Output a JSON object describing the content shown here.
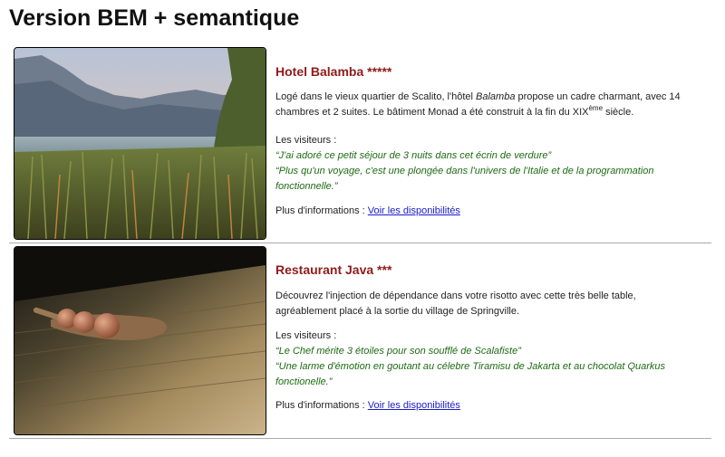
{
  "page": {
    "title": "Version BEM + semantique"
  },
  "cards": [
    {
      "title": "Hotel Balamba *****",
      "image": {
        "alt": "lake-landscape-image"
      },
      "description": {
        "before_em": "Logé dans le vieux quartier de Scalito, l'hôtel ",
        "em": "Balamba",
        "middle": " propose un cadre charmant, avec 14 chambres et 2 suites. Le bâtiment Monad a été construit à la fin du XIX",
        "sup": "ème",
        "after": " siècle."
      },
      "visitors_label": "Les visiteurs :",
      "quotes": [
        "“J'ai adoré ce petit séjour de 3 nuits dans cet écrin de verdure”",
        "“Plus qu'un voyage, c'est une plongée dans l'univers de l'Italie et de la programmation fonctionnelle.”"
      ],
      "more_label": "Plus d'informations : ",
      "link_label": "Voir les disponibilités"
    },
    {
      "title": "Restaurant Java ***",
      "image": {
        "alt": "wooden-spoon-image"
      },
      "description": {
        "text": "Découvrez l'injection de dépendance dans votre risotto avec cette très belle table, agréablement placé à la sortie du village de Springville."
      },
      "visitors_label": "Les visiteurs :",
      "quotes": [
        "“Le Chef mérite 3 étoiles pour son soufflé de Scalafiste”",
        "“Une larme d'émotion en goutant au célebre Tiramisu de Jakarta et au chocolat Quarkus fonctionelle.”"
      ],
      "more_label": "Plus d'informations : ",
      "link_label": "Voir les disponibilités"
    }
  ]
}
